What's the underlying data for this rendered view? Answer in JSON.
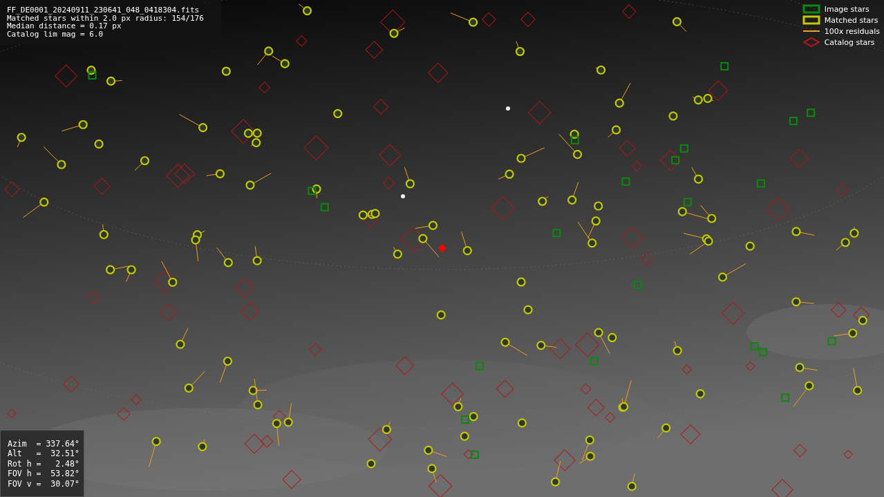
{
  "info": {
    "lines": [
      "FF_DE0001_20240911_230641_048_0418304.fits",
      "Matched stars within 2.0 px radius: 154/176",
      "Median distance = 0.17 px",
      "Catalog lim mag = 6.0"
    ]
  },
  "legend": [
    {
      "kind": "box",
      "color": "#0a8a0a",
      "label": "Image stars"
    },
    {
      "kind": "box",
      "color": "#c8c800",
      "label": "Matched stars"
    },
    {
      "kind": "line",
      "color": "#f0a020",
      "label": "100x residuals"
    },
    {
      "kind": "diamond",
      "color": "#b01818",
      "label": "Catalog stars"
    }
  ],
  "pointing": {
    "lines": [
      "Azim  = 337.64°",
      "Alt   =  32.51°",
      "Rot h =   2.48°",
      "FOV h =  53.82°",
      "FOV v =  30.07°"
    ]
  }
}
